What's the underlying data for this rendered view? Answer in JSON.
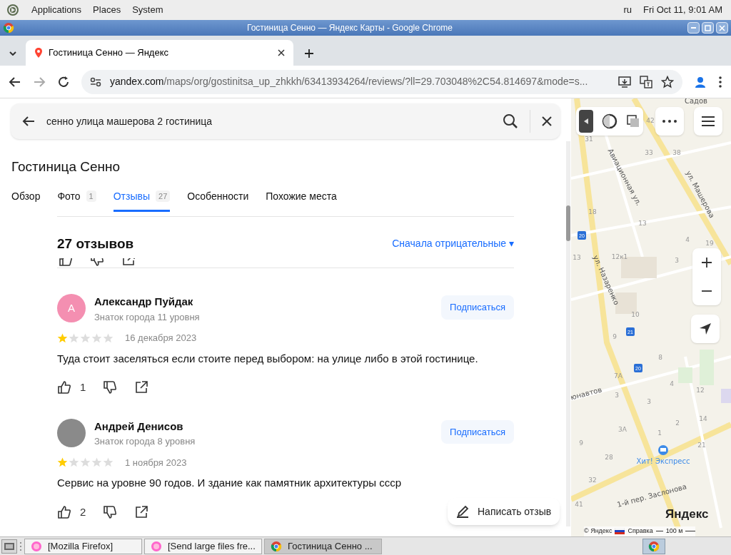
{
  "system_panel": {
    "menus": [
      "Applications",
      "Places",
      "System"
    ],
    "keyboard_layout": "ru",
    "clock": "Fri Oct 11,  9:01 AM"
  },
  "window": {
    "title": "Гостиница Сенно — Яндекс Карты - Google Chrome"
  },
  "browser": {
    "tabs": [
      {
        "label": "Гостиница Сенно — Яндекс",
        "selected": true
      }
    ],
    "url_host": "yandex.com",
    "url_path": "/maps/org/gostinitsa_up_zhkkh/63413934264/reviews/?ll=29.703048%2C54.814697&mode=s..."
  },
  "search": {
    "value": "сенно улица машерова 2 гостиница"
  },
  "place": {
    "title": "Гостиница Сенно",
    "tabs": [
      {
        "label": "Обзор",
        "selected": false
      },
      {
        "label": "Фото",
        "count": "1",
        "selected": false
      },
      {
        "label": "Отзывы",
        "count": "27",
        "selected": true
      },
      {
        "label": "Особенности",
        "selected": false
      },
      {
        "label": "Похожие места",
        "selected": false
      }
    ],
    "reviews_count": "27 отзывов",
    "sort": "Сначала отрицательные ▾",
    "reviews": [
      {
        "author": "Александр Пуйдак",
        "avatar": {
          "kind": "letter",
          "letter": "А",
          "color": "#f48fb1"
        },
        "level": "Знаток города 11 уровня",
        "stars": 1,
        "date": "16 декабря 2023",
        "text": "Туда стоит заселяться если стоите перед выбором: на улице либо в этой гостинице.",
        "likes": "1",
        "subscribe": "Подписаться"
      },
      {
        "author": "Андрей Денисов",
        "avatar": {
          "kind": "photo"
        },
        "level": "Знаток города 8 уровня",
        "stars": 1,
        "date": "1 ноября 2023",
        "text": "Сервис на уровне 90 годов. И здание как памятник архитектуры ссср",
        "likes": "2",
        "subscribe": "Подписаться"
      }
    ],
    "write_review": "Написать отзыв"
  },
  "map": {
    "streets": [
      "Садов",
      "Авиационная ул.",
      "ул. Машерова",
      "ул. Назаренко",
      "юнавтов",
      "1-й пер. Заслонова"
    ],
    "house_numbers": [
      "31",
      "42",
      "33",
      "38",
      "18",
      "13",
      "4",
      "19",
      "13",
      "12к1",
      "3",
      "10",
      "9",
      "8",
      "7А",
      "4",
      "12",
      "3",
      "3",
      "14",
      "2",
      "1",
      "3А",
      "9",
      "21",
      "28",
      "32",
      "41"
    ],
    "bus_stops": [
      "20",
      "21",
      "20"
    ],
    "poi": "Хит! Экспресс",
    "logo": "Яндекс",
    "copyright": "© Яндекс",
    "help": "Справка",
    "scale": "100 м"
  },
  "taskbar": {
    "items": [
      {
        "label": "[Mozilla Firefox]",
        "kind": "firefox",
        "selected": false
      },
      {
        "label": "[Send large files fre...",
        "kind": "firefox",
        "selected": false
      },
      {
        "label": "Гостиница Сенно ...",
        "kind": "chrome",
        "selected": true
      }
    ]
  }
}
